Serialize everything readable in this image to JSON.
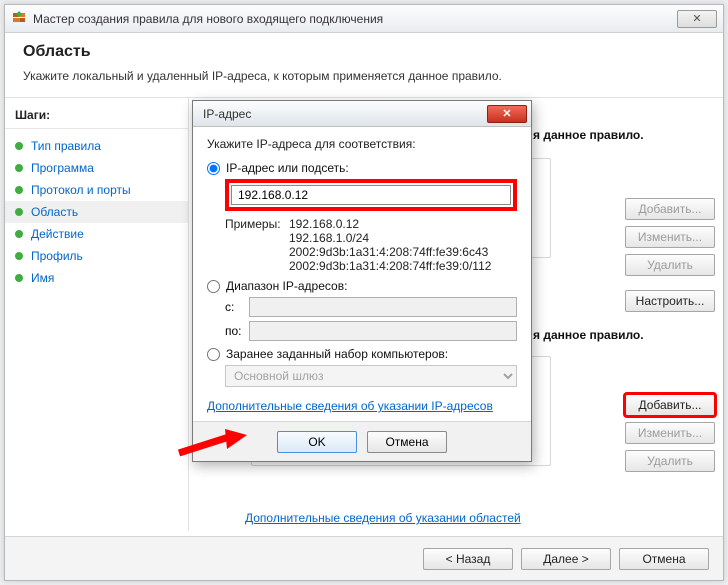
{
  "window": {
    "title": "Мастер создания правила для нового входящего подключения",
    "close_glyph": "✕"
  },
  "header": {
    "title": "Область",
    "subtitle": "Укажите локальный и удаленный IP-адреса, к которым применяется данное правило."
  },
  "sidebar": {
    "header": "Шаги:",
    "items": [
      {
        "label": "Тип правила"
      },
      {
        "label": "Программа"
      },
      {
        "label": "Протокол и порты"
      },
      {
        "label": "Область"
      },
      {
        "label": "Действие"
      },
      {
        "label": "Профиль"
      },
      {
        "label": "Имя"
      }
    ],
    "current_index": 3
  },
  "main": {
    "rule_text_1": "я данное правило.",
    "rule_text_2": "я данное правило.",
    "buttons": {
      "add": "Добавить...",
      "edit": "Изменить...",
      "delete": "Удалить",
      "configure": "Настроить..."
    },
    "link": "Дополнительные сведения об указании областей"
  },
  "footer": {
    "back": "< Назад",
    "next": "Далее >",
    "cancel": "Отмена"
  },
  "dialog": {
    "title": "IP-адрес",
    "close_glyph": "✕",
    "prompt": "Укажите IP-адреса для соответствия:",
    "opt_ip_label": "IP-адрес или подсеть:",
    "ip_value": "192.168.0.12",
    "examples_label": "Примеры:",
    "examples": [
      "192.168.0.12",
      "192.168.1.0/24",
      "2002:9d3b:1a31:4:208:74ff:fe39:6c43",
      "2002:9d3b:1a31:4:208:74ff:fe39:0/112"
    ],
    "opt_range_label": "Диапазон IP-адресов:",
    "range_from_label": "c:",
    "range_to_label": "по:",
    "range_from": "",
    "range_to": "",
    "opt_preset_label": "Заранее заданный набор компьютеров:",
    "preset_selected": "Основной шлюз",
    "link": "Дополнительные сведения об указании IP-адресов",
    "ok": "OK",
    "cancel": "Отмена"
  }
}
